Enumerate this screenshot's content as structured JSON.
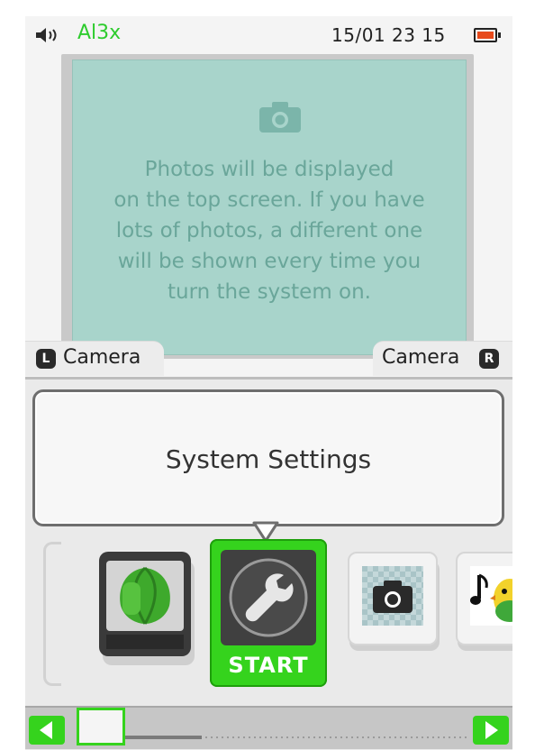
{
  "status_bar": {
    "signal_text": "Al3x",
    "datetime": "15/01 23 15",
    "battery_color": "#e84a1c",
    "volume_icon": "speaker-icon"
  },
  "photo_panel": {
    "icon": "camera-icon",
    "message": "Photos will be displayed\non the top screen. If you have\nlots of photos, a different one\nwill be shown every time you\nturn the system on."
  },
  "tabs": {
    "left": {
      "button": "L",
      "label": "Camera"
    },
    "right": {
      "button": "R",
      "label": "Camera"
    }
  },
  "selected_app": {
    "title": "System Settings"
  },
  "apps": [
    {
      "name": "animal-crossing",
      "icon": "leaf-icon"
    },
    {
      "name": "system-settings",
      "icon": "wrench-icon",
      "label": "START"
    },
    {
      "name": "camera",
      "icon": "camera-icon"
    },
    {
      "name": "sound",
      "icon": "music-note-icon"
    }
  ],
  "colors": {
    "accent": "#35d31d",
    "photo_bg": "#a8d4cb",
    "photo_text": "#6aa69a"
  }
}
